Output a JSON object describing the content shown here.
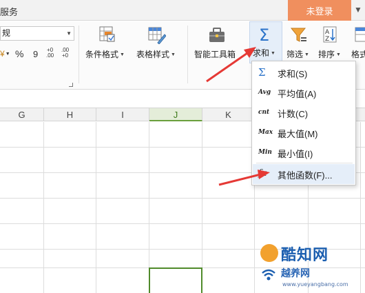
{
  "titlebar": {
    "menu_fragment": "服务",
    "login_label": "未登录"
  },
  "ribbon": {
    "number_format_value": "规",
    "percent_symbol": "%",
    "comma_symbol": "9",
    "currency_symbol": "¥",
    "inc_decimal_top": "+0",
    "inc_decimal_bottom": ".00",
    "dec_decimal_top": ".00",
    "dec_decimal_bottom": "+0",
    "conditional_format_label": "条件格式",
    "table_style_label": "表格样式",
    "smart_toolbox_label": "智能工具箱",
    "sum_label": "求和",
    "filter_label": "筛选",
    "sort_label": "排序",
    "format_label": "格式"
  },
  "columns": [
    "G",
    "H",
    "I",
    "J",
    "K"
  ],
  "active_column": "J",
  "sum_menu": {
    "items": [
      {
        "icon": "Σ",
        "label": "求和(S)"
      },
      {
        "icon": "Avg",
        "label": "平均值(A)"
      },
      {
        "icon": "cnt",
        "label": "计数(C)"
      },
      {
        "icon": "Max",
        "label": "最大值(M)"
      },
      {
        "icon": "Min",
        "label": "最小值(I)"
      },
      {
        "icon": "fx",
        "label": "其他函数(F)..."
      }
    ],
    "highlighted_index": 5
  },
  "watermark": {
    "brand_top": "酷知网",
    "brand_bottom": "越养网",
    "url": "www.yueyangbang.com"
  },
  "colors": {
    "accent_orange": "#f08f5e",
    "sum_blue": "#2b73c9",
    "highlight": "#e5eef9",
    "selection_green": "#4f8a2a",
    "arrow_red": "#e53935"
  }
}
